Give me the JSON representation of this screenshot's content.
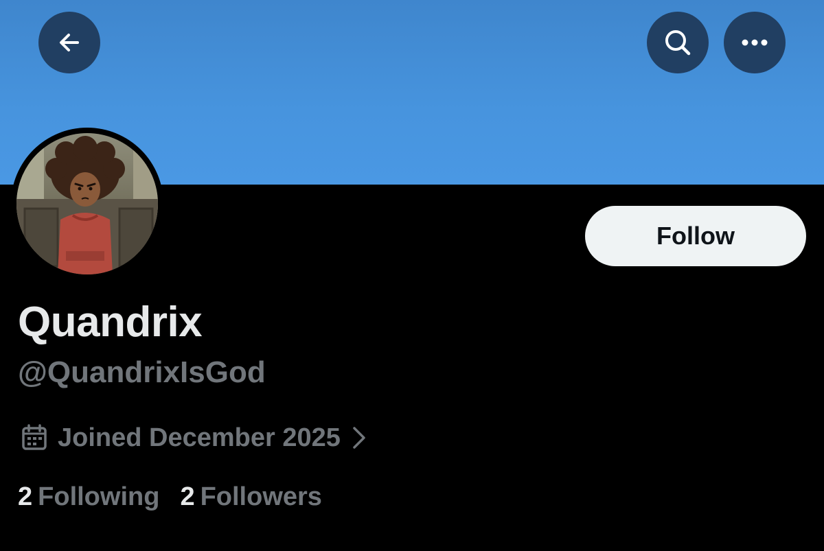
{
  "header": {
    "back_icon": "arrow-left-icon",
    "search_icon": "search-icon",
    "more_icon": "more-horizontal-icon",
    "banner_color": "#4794de"
  },
  "profile": {
    "display_name": "Quandrix",
    "handle": "@QuandrixIsGod",
    "joined": "Joined December 2025",
    "joined_icon": "calendar-icon"
  },
  "actions": {
    "follow_label": "Follow"
  },
  "stats": {
    "following_count": "2",
    "following_label": "Following",
    "followers_count": "2",
    "followers_label": "Followers"
  },
  "colors": {
    "background": "#000000",
    "primary_text": "#e7e9ea",
    "secondary_text": "#71767b",
    "button_bg": "#eff3f4"
  }
}
